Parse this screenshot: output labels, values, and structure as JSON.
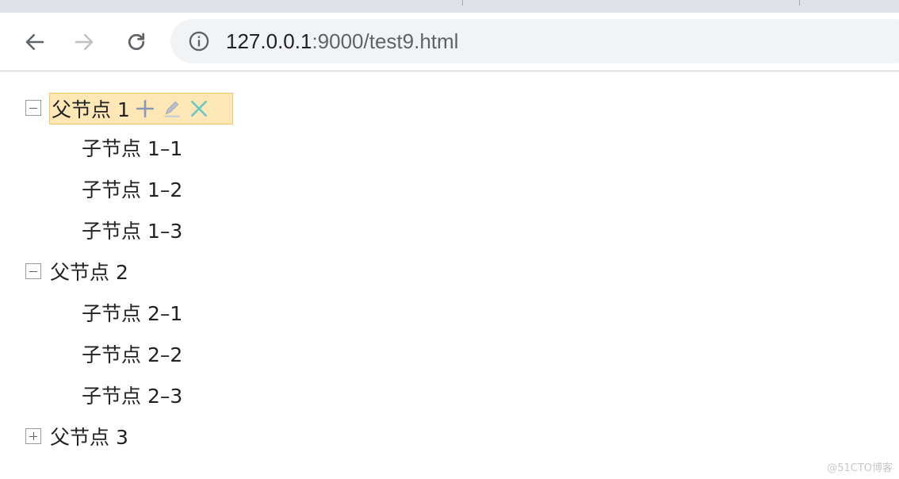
{
  "browser": {
    "url_host": "127.0.0.1",
    "url_rest": ":9000/test9.html",
    "icons": {
      "back": "arrow-left-icon",
      "forward": "arrow-right-icon",
      "reload": "reload-icon",
      "info": "info-icon"
    }
  },
  "tree": {
    "selected_colors": {
      "background": "#fde7b6",
      "border": "#f0c66d"
    },
    "nodes": [
      {
        "label": "父节点 1",
        "expanded": true,
        "selected": true,
        "actions": [
          "add-icon",
          "edit-icon",
          "remove-icon"
        ],
        "children": [
          "子节点 1–1",
          "子节点 1–2",
          "子节点 1–3"
        ]
      },
      {
        "label": "父节点 2",
        "expanded": true,
        "children": [
          "子节点 2–1",
          "子节点 2–2",
          "子节点 2–3"
        ]
      },
      {
        "label": "父节点 3",
        "expanded": false,
        "children": []
      }
    ]
  },
  "watermark": "@51CTO博客"
}
